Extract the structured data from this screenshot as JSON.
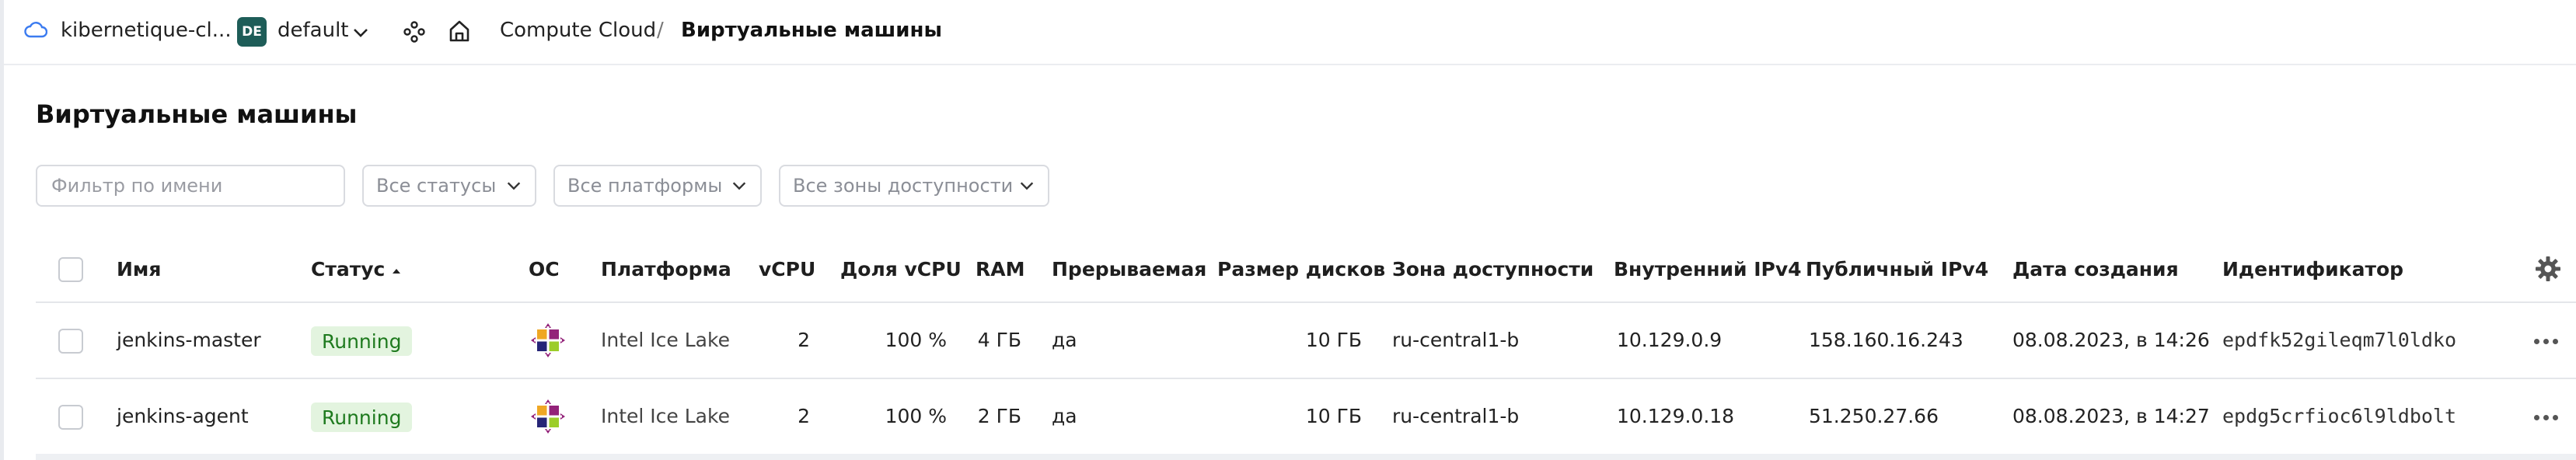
{
  "topbar": {
    "cloud_name": "kibernetique-cl...",
    "folder_avatar": "DE",
    "folder_name": "default",
    "breadcrumb": [
      "Compute Cloud",
      "/",
      "Виртуальные машины"
    ],
    "icons": [
      "cloud-icon",
      "chevron-down-icon",
      "services-icon",
      "home-icon"
    ]
  },
  "page": {
    "title": "Виртуальные машины"
  },
  "filters": {
    "name_placeholder": "Фильтр по имени",
    "status": "Все статусы",
    "platform": "Все платформы",
    "zone": "Все зоны доступности"
  },
  "table": {
    "columns": [
      "Имя",
      "Статус",
      "ОС",
      "Платформа",
      "vCPU",
      "Доля vCPU",
      "RAM",
      "Прерываемая",
      "Размер дисков",
      "Зона доступности",
      "Внутренний IPv4",
      "Публичный IPv4",
      "Дата создания",
      "Идентификатор"
    ],
    "sort_column": "Статус",
    "sort_direction": "asc",
    "rows": [
      {
        "name": "jenkins-master",
        "status": "Running",
        "os": "centos-icon",
        "platform": "Intel Ice Lake",
        "vcpu": "2",
        "vcpu_share": "100 %",
        "ram": "4 ГБ",
        "preemptible": "да",
        "disk": "10 ГБ",
        "zone": "ru-central1-b",
        "internal_ip": "10.129.0.9",
        "public_ip": "158.160.16.243",
        "created": "08.08.2023, в 14:26",
        "id": "epdfk52gileqm7l0ldko"
      },
      {
        "name": "jenkins-agent",
        "status": "Running",
        "os": "centos-icon",
        "platform": "Intel Ice Lake",
        "vcpu": "2",
        "vcpu_share": "100 %",
        "ram": "2 ГБ",
        "preemptible": "да",
        "disk": "10 ГБ",
        "zone": "ru-central1-b",
        "internal_ip": "10.129.0.18",
        "public_ip": "51.250.27.66",
        "created": "08.08.2023, в 14:27",
        "id": "epdg5crfioc6l9ldbolt"
      }
    ]
  },
  "colors": {
    "status_running_bg": "#e3f4df",
    "status_running_text": "#1e7a1e",
    "avatar_bg": "#1e5d58"
  }
}
